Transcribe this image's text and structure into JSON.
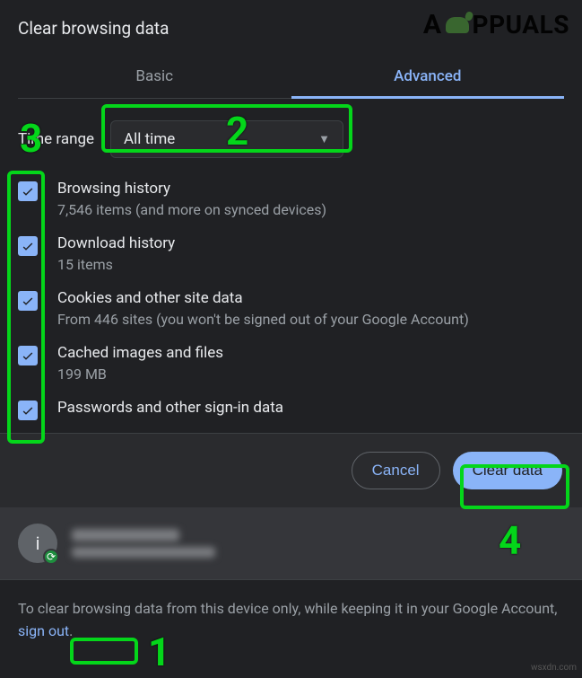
{
  "dialog": {
    "title": "Clear browsing data",
    "tabs": {
      "basic": "Basic",
      "advanced": "Advanced"
    },
    "timerange": {
      "label": "Time range",
      "value": "All time"
    },
    "options": [
      {
        "title": "Browsing history",
        "sub": "7,546 items (and more on synced devices)"
      },
      {
        "title": "Download history",
        "sub": "15 items"
      },
      {
        "title": "Cookies and other site data",
        "sub": "From 446 sites (you won't be signed out of your Google Account)"
      },
      {
        "title": "Cached images and files",
        "sub": "199 MB"
      },
      {
        "title": "Passwords and other sign-in data",
        "sub": ""
      }
    ],
    "buttons": {
      "cancel": "Cancel",
      "clear": "Clear data"
    }
  },
  "account": {
    "initial": "i"
  },
  "footer": {
    "prefix": "To clear browsing data from this device only, while keeping it in your Google Account, ",
    "link": "sign out",
    "suffix": "."
  },
  "annotations": {
    "n1": "1",
    "n2": "2",
    "n3": "3",
    "n4": "4"
  },
  "watermark": {
    "brand_prefix": "A",
    "brand_rest": "PPUALS",
    "credit": "wsxdn.com"
  }
}
